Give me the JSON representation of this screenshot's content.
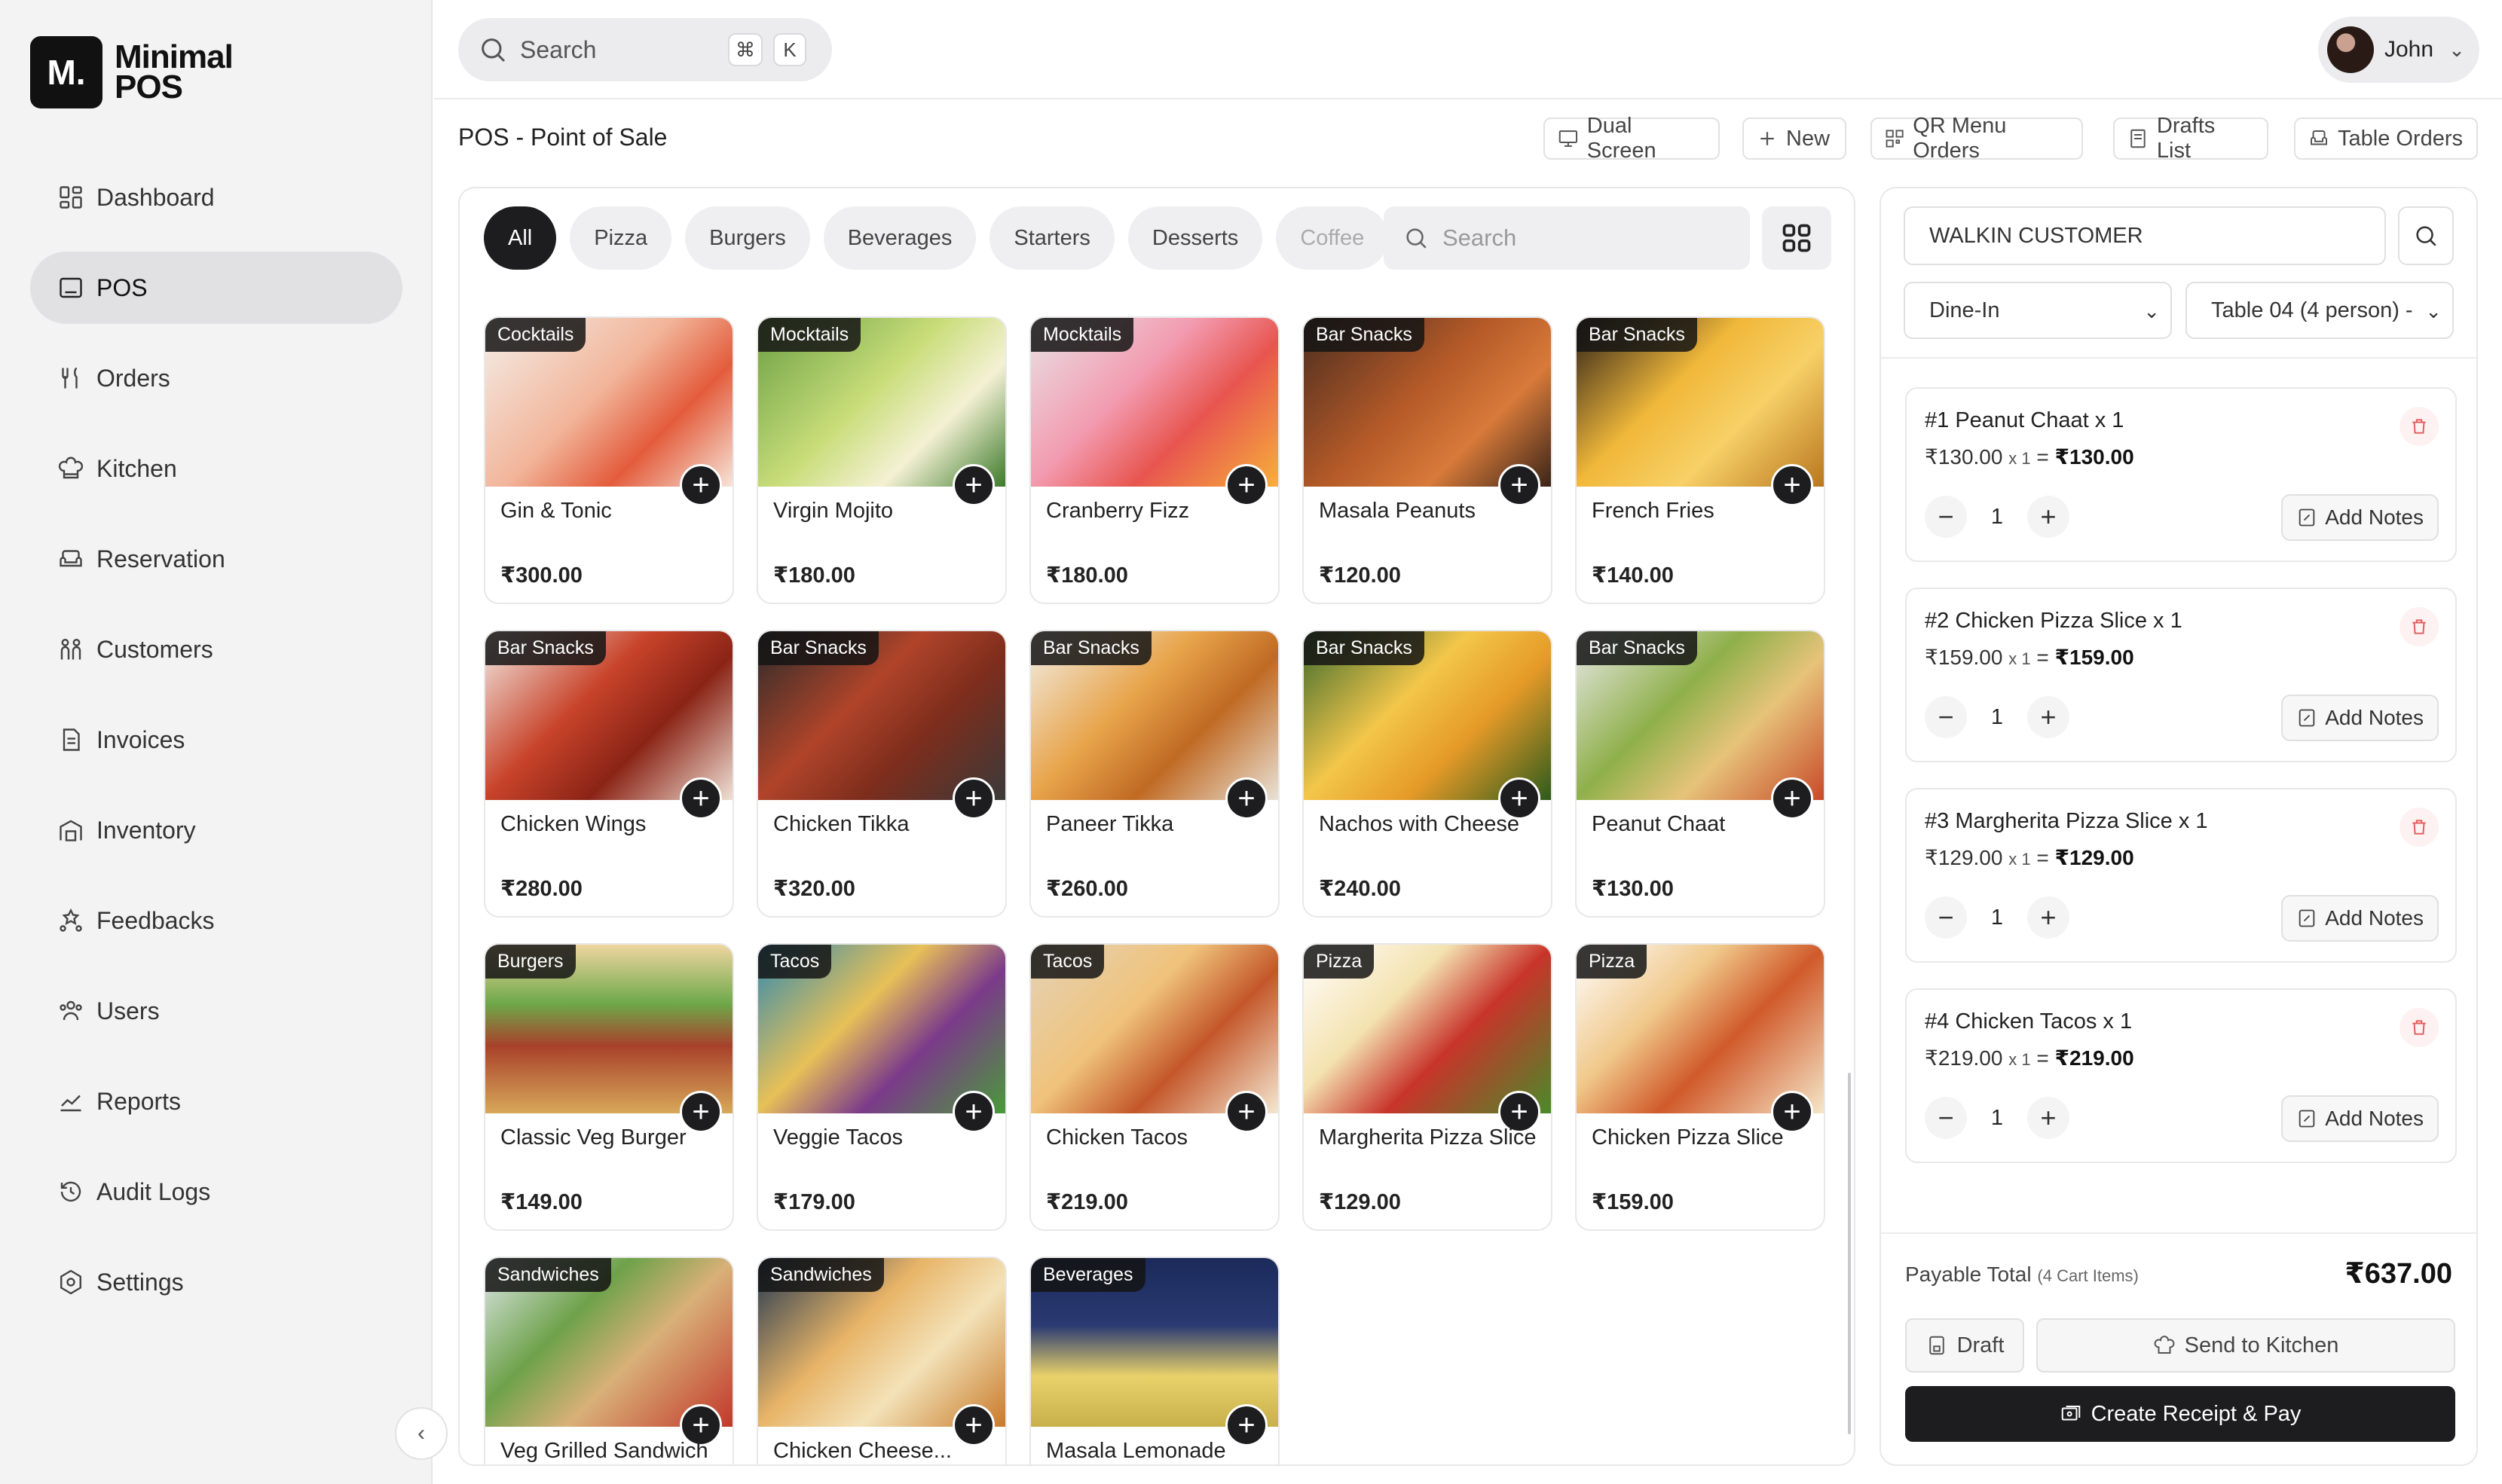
{
  "app": {
    "logo_mark": "M.",
    "logo_line1": "Minimal",
    "logo_line2": "POS"
  },
  "sidebar": {
    "items": [
      {
        "label": "Dashboard",
        "icon": "dashboard-icon",
        "active": false
      },
      {
        "label": "POS",
        "icon": "pos-icon",
        "active": true
      },
      {
        "label": "Orders",
        "icon": "utensils-icon",
        "active": false
      },
      {
        "label": "Kitchen",
        "icon": "chef-hat-icon",
        "active": false
      },
      {
        "label": "Reservation",
        "icon": "sofa-icon",
        "active": false
      },
      {
        "label": "Customers",
        "icon": "people-icon",
        "active": false
      },
      {
        "label": "Invoices",
        "icon": "invoice-icon",
        "active": false
      },
      {
        "label": "Inventory",
        "icon": "warehouse-icon",
        "active": false
      },
      {
        "label": "Feedbacks",
        "icon": "feedback-icon",
        "active": false
      },
      {
        "label": "Users",
        "icon": "users-icon",
        "active": false
      },
      {
        "label": "Reports",
        "icon": "reports-icon",
        "active": false
      },
      {
        "label": "Audit Logs",
        "icon": "history-icon",
        "active": false
      },
      {
        "label": "Settings",
        "icon": "settings-icon",
        "active": false
      }
    ],
    "collapse_glyph": "‹"
  },
  "topbar": {
    "search_placeholder": "Search",
    "kbd_cmd": "⌘",
    "kbd_k": "K",
    "user_name": "John"
  },
  "page": {
    "title": "POS - Point of Sale",
    "buttons": {
      "dual_screen": "Dual Screen",
      "new": "New",
      "qr_orders": "QR Menu Orders",
      "drafts": "Drafts List",
      "table_orders": "Table Orders"
    }
  },
  "categories": [
    "All",
    "Pizza",
    "Burgers",
    "Beverages",
    "Starters",
    "Desserts",
    "Coffee"
  ],
  "product_search_placeholder": "Search",
  "products": [
    {
      "tag": "Cocktails",
      "name": "Gin & Tonic",
      "price": "₹300.00"
    },
    {
      "tag": "Mocktails",
      "name": "Virgin Mojito",
      "price": "₹180.00"
    },
    {
      "tag": "Mocktails",
      "name": "Cranberry Fizz",
      "price": "₹180.00"
    },
    {
      "tag": "Bar Snacks",
      "name": "Masala Peanuts",
      "price": "₹120.00"
    },
    {
      "tag": "Bar Snacks",
      "name": "French Fries",
      "price": "₹140.00"
    },
    {
      "tag": "Bar Snacks",
      "name": "Chicken Wings",
      "price": "₹280.00"
    },
    {
      "tag": "Bar Snacks",
      "name": "Chicken Tikka",
      "price": "₹320.00"
    },
    {
      "tag": "Bar Snacks",
      "name": "Paneer Tikka",
      "price": "₹260.00"
    },
    {
      "tag": "Bar Snacks",
      "name": "Nachos with Cheese",
      "price": "₹240.00"
    },
    {
      "tag": "Bar Snacks",
      "name": "Peanut Chaat",
      "price": "₹130.00"
    },
    {
      "tag": "Burgers",
      "name": "Classic Veg Burger",
      "price": "₹149.00"
    },
    {
      "tag": "Tacos",
      "name": "Veggie Tacos",
      "price": "₹179.00"
    },
    {
      "tag": "Tacos",
      "name": "Chicken Tacos",
      "price": "₹219.00"
    },
    {
      "tag": "Pizza",
      "name": "Margherita Pizza Slice",
      "price": "₹129.00"
    },
    {
      "tag": "Pizza",
      "name": "Chicken Pizza Slice",
      "price": "₹159.00"
    },
    {
      "tag": "Sandwiches",
      "name": "Veg Grilled Sandwich",
      "price": ""
    },
    {
      "tag": "Sandwiches",
      "name": "Chicken Cheese...",
      "price": ""
    },
    {
      "tag": "Beverages",
      "name": "Masala Lemonade",
      "price": ""
    }
  ],
  "cart": {
    "customer": "WALKIN CUSTOMER",
    "order_type": "Dine-In",
    "table": "Table 04 (4 person) -",
    "items": [
      {
        "title": "#1 Peanut Chaat x 1",
        "unit": "₹130.00",
        "mult": "x 1",
        "total": "₹130.00",
        "qty": "1",
        "notes_label": "Add Notes"
      },
      {
        "title": "#2 Chicken Pizza Slice x 1",
        "unit": "₹159.00",
        "mult": "x 1",
        "total": "₹159.00",
        "qty": "1",
        "notes_label": "Add Notes"
      },
      {
        "title": "#3 Margherita Pizza Slice x 1",
        "unit": "₹129.00",
        "mult": "x 1",
        "total": "₹129.00",
        "qty": "1",
        "notes_label": "Add Notes"
      },
      {
        "title": "#4 Chicken Tacos x 1",
        "unit": "₹219.00",
        "mult": "x 1",
        "total": "₹219.00",
        "qty": "1",
        "notes_label": "Add Notes"
      }
    ],
    "payable_label": "Payable Total",
    "payable_sub": "(4 Cart Items)",
    "payable_total": "₹637.00",
    "draft_label": "Draft",
    "kitchen_label": "Send to Kitchen",
    "receipt_label": "Create Receipt & Pay"
  },
  "colors": {
    "accent": "#1d1d1f",
    "sidebar_bg": "#f3f3f4",
    "delete_red": "#e25c5c"
  }
}
